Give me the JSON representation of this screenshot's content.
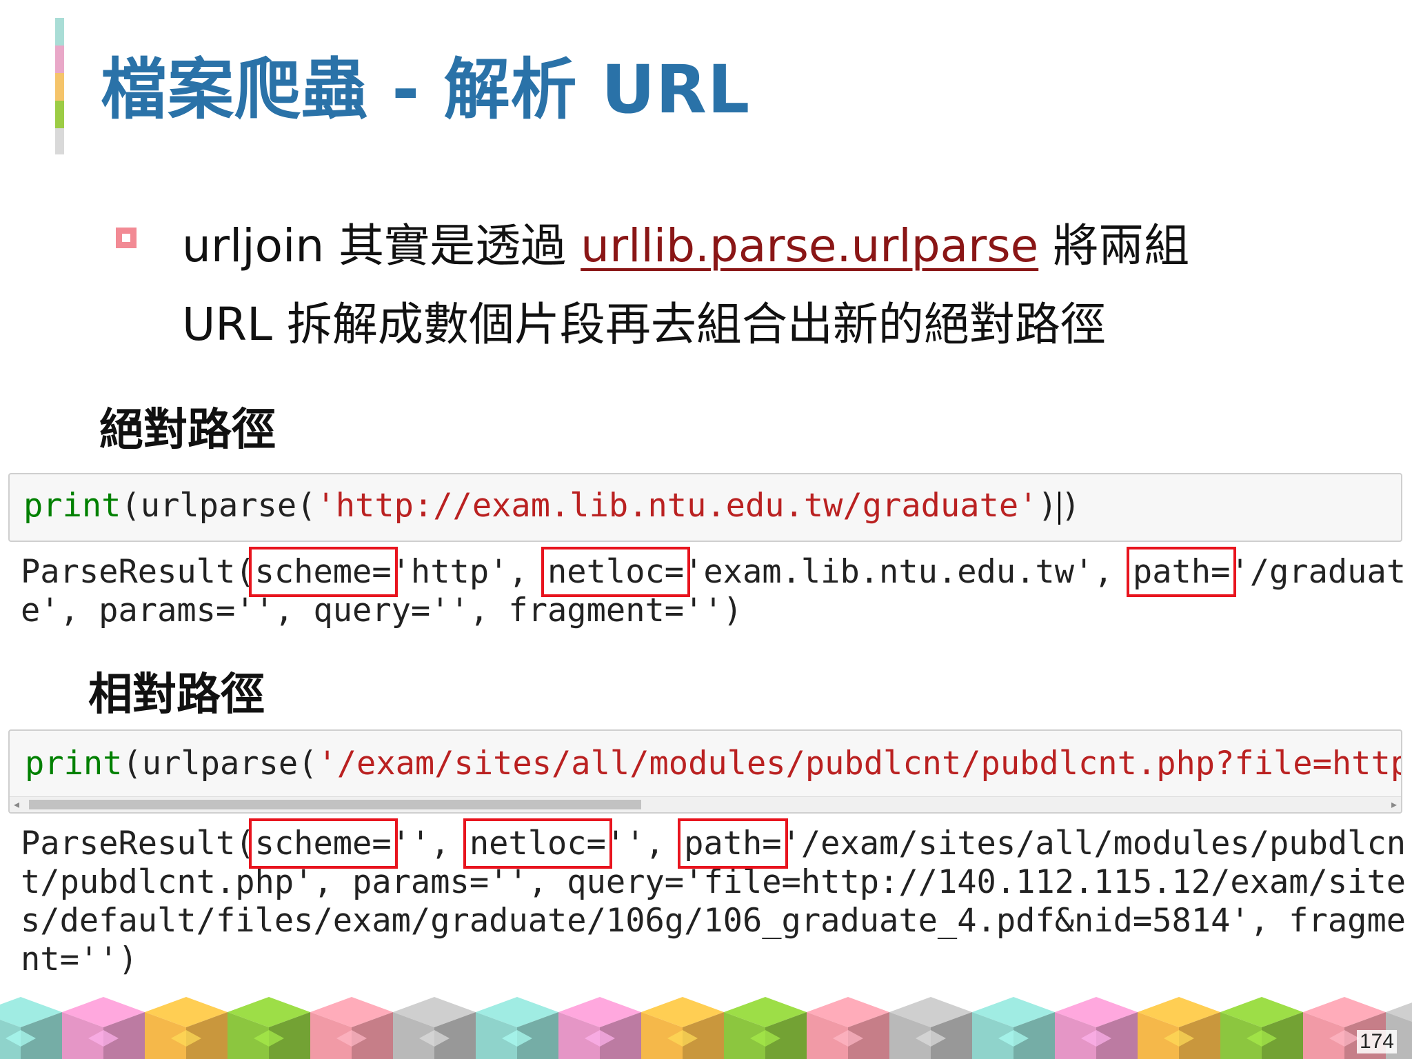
{
  "slide": {
    "title": "檔案爬蟲 - 解析 URL",
    "page_number": "174",
    "accent_colors": [
      "#a9ddd6",
      "#e9a8c8",
      "#f5c46a",
      "#9ccc45",
      "#d9d9d9"
    ]
  },
  "bullet": {
    "prefix": "urljoin 其實是透過 ",
    "link": "urllib.parse.urlparse",
    "suffix_line1": " 將兩組",
    "line2": "URL 拆解成數個片段再去組合出新的絕對路徑"
  },
  "absolute": {
    "label": "絕對路徑",
    "code": {
      "func": "print",
      "pre": "(urlparse(",
      "arg": "'http://exam.lib.ntu.edu.tw/graduate'",
      "close1": ")",
      "close2": ")"
    },
    "output": {
      "prefix": "ParseResult(",
      "key_scheme": "scheme=",
      "val_scheme": "'http', ",
      "key_netloc": "netloc=",
      "val_netloc": "'exam.lib.ntu.edu.tw', ",
      "key_path": "path=",
      "val_path": "'/graduat",
      "line2": "e', params='', query='', fragment='')"
    }
  },
  "relative": {
    "label": "相對路徑",
    "code": {
      "func": "print",
      "pre": "(urlparse(",
      "arg": "'/exam/sites/all/modules/pubdlcnt/pubdlcnt.php?file=http:"
    },
    "output": {
      "prefix": "ParseResult(",
      "key_scheme": "scheme=",
      "val_scheme": "'', ",
      "key_netloc": "netloc=",
      "val_netloc": "'', ",
      "key_path": "path=",
      "val_path": "'/exam/sites/all/modules/pubdlcn",
      "line2": "t/pubdlcnt.php', params='', query='file=http://140.112.115.12/exam/site",
      "line3": "s/default/files/exam/graduate/106g/106_graduate_4.pdf&nid=5814', fragme",
      "line4": "nt='')"
    }
  },
  "footer": {
    "cube_colors": [
      "#8fd3cb",
      "#e596c6",
      "#f5b84a",
      "#8cc63f",
      "#f19aa6",
      "#b9b9b9"
    ]
  }
}
